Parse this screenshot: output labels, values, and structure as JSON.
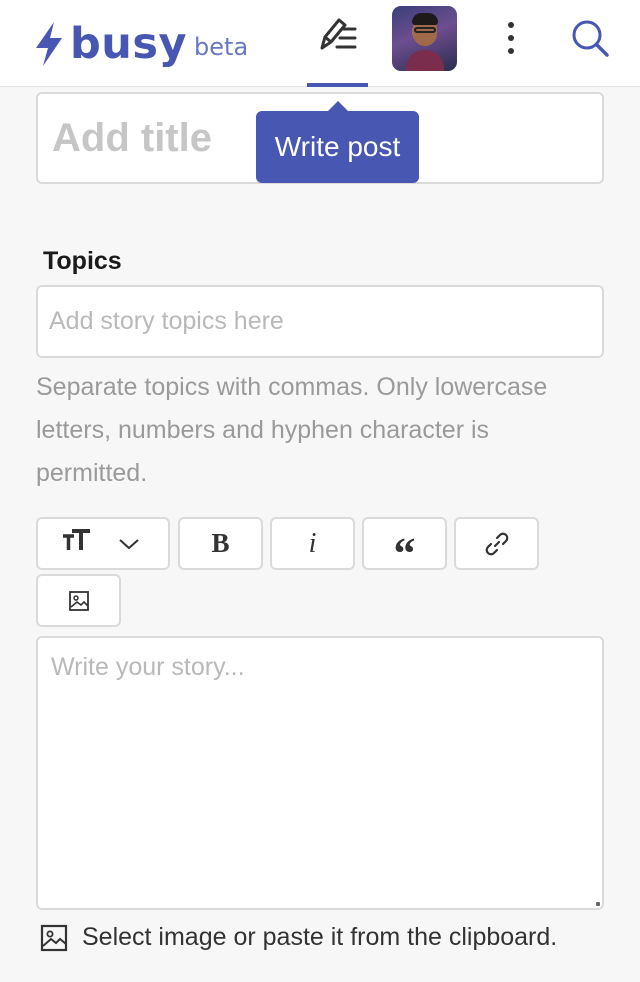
{
  "header": {
    "logo_text": "busy",
    "logo_badge": "beta",
    "write_icon": "write-post-icon",
    "menu_icon": "more-vertical-icon",
    "search_icon": "search-icon",
    "brand_color": "#4757b2"
  },
  "tooltip": {
    "text": "Write post"
  },
  "editor": {
    "title_placeholder": "Add title",
    "topics_label": "Topics",
    "topics_placeholder": "Add story topics here",
    "topics_hint": "Separate topics with commas. Only lowercase letters, numbers and hyphen character is permitted.",
    "toolbar": {
      "bold_label": "B",
      "italic_label": "i",
      "quote_label": "“",
      "heading_icon": "text-size-icon",
      "link_icon": "link-icon",
      "image_icon": "image-icon"
    },
    "body_placeholder": "Write your story...",
    "upload_text": "Select image or paste it from the clipboard."
  }
}
